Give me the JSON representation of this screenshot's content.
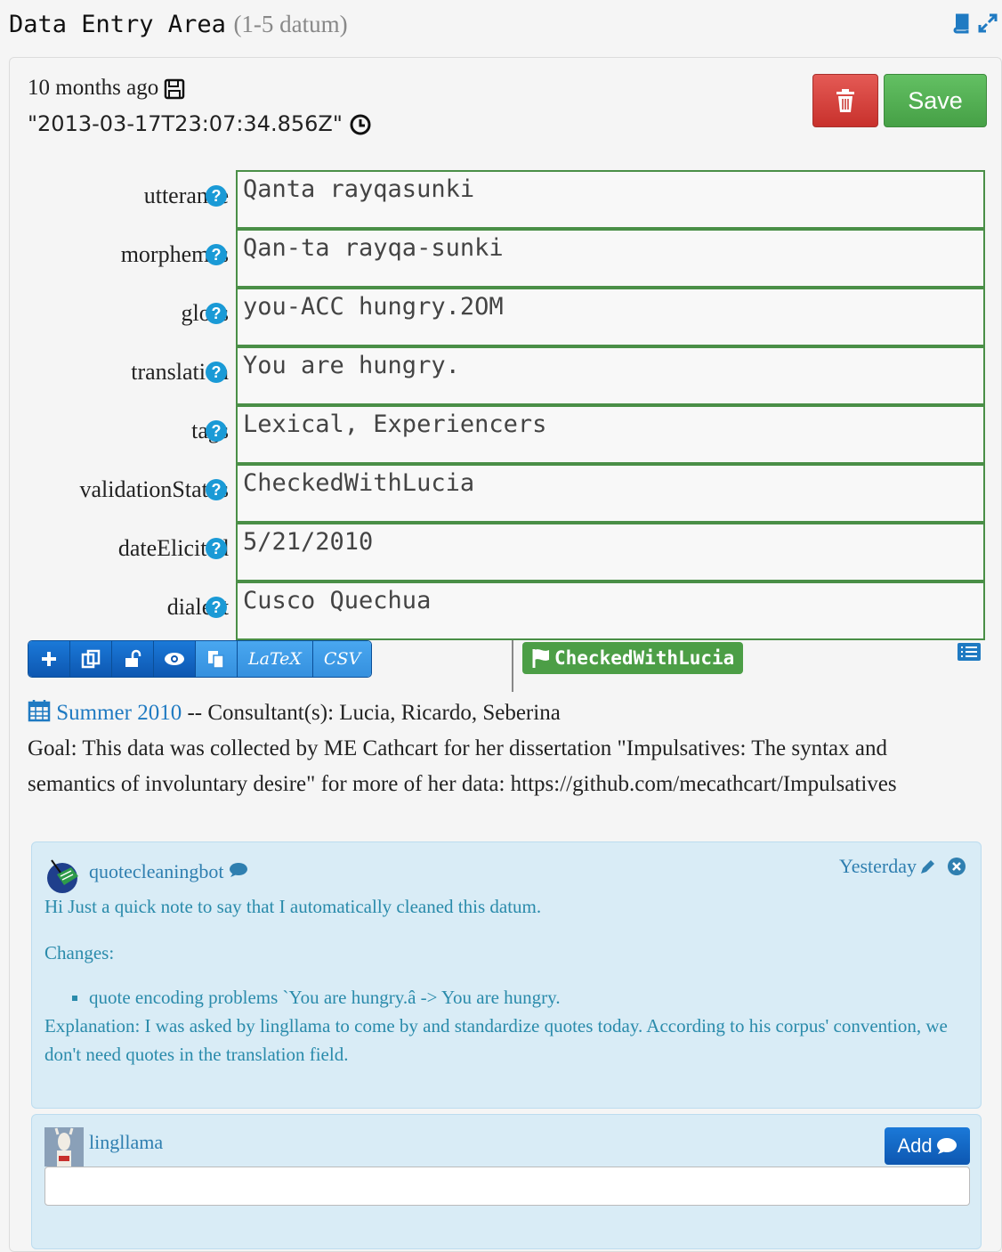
{
  "header": {
    "title": "Data Entry Area",
    "count": "(1-5 datum)"
  },
  "meta": {
    "modified": "10 months ago",
    "timestamp": "\"2013-03-17T23:07:34.856Z\""
  },
  "actions": {
    "save_label": "Save"
  },
  "fields": [
    {
      "label": "utterance",
      "value": "Qanta rayqasunki"
    },
    {
      "label": "morphemes",
      "value": "Qan-ta rayqa-sunki"
    },
    {
      "label": "gloss",
      "value": "you-ACC hungry.2OM"
    },
    {
      "label": "translation",
      "value": "You are hungry."
    },
    {
      "label": "tags",
      "value": "Lexical, Experiencers"
    },
    {
      "label": "validationStatus",
      "value": "CheckedWithLucia"
    },
    {
      "label": "dateElicited",
      "value": "5/21/2010"
    },
    {
      "label": "dialect",
      "value": "Cusco Quechua"
    }
  ],
  "toolbar": {
    "latex_label": "LaTeX",
    "csv_label": "CSV"
  },
  "status_badge": "CheckedWithLucia",
  "session": {
    "link": "Summer 2010",
    "consultants": " -- Consultant(s): Lucia, Ricardo, Seberina",
    "goal": "Goal: This data was collected by ME Cathcart for her dissertation \"Impulsatives: The syntax and semantics of involuntary desire\" for more of her data: https://github.com/mecathcart/Impulsatives"
  },
  "comment": {
    "user": "quotecleaningbot",
    "time": "Yesterday",
    "line1": "Hi Just a quick note to say that I automatically cleaned this datum.",
    "line2": "Changes:",
    "bullet": "quote encoding problems `You are hungry.â -> You are hungry.",
    "line3": "Explanation: I was asked by lingllama to come by and standardize quotes today. According to his corpus' convention, we don't need quotes in the translation field."
  },
  "new_comment": {
    "user": "lingllama",
    "add_label": "Add",
    "value": ""
  },
  "colors": {
    "accent_blue": "#0d57b1",
    "field_border": "#4a8f47",
    "status_green": "#4c9e46",
    "delete_red": "#c8312c"
  }
}
